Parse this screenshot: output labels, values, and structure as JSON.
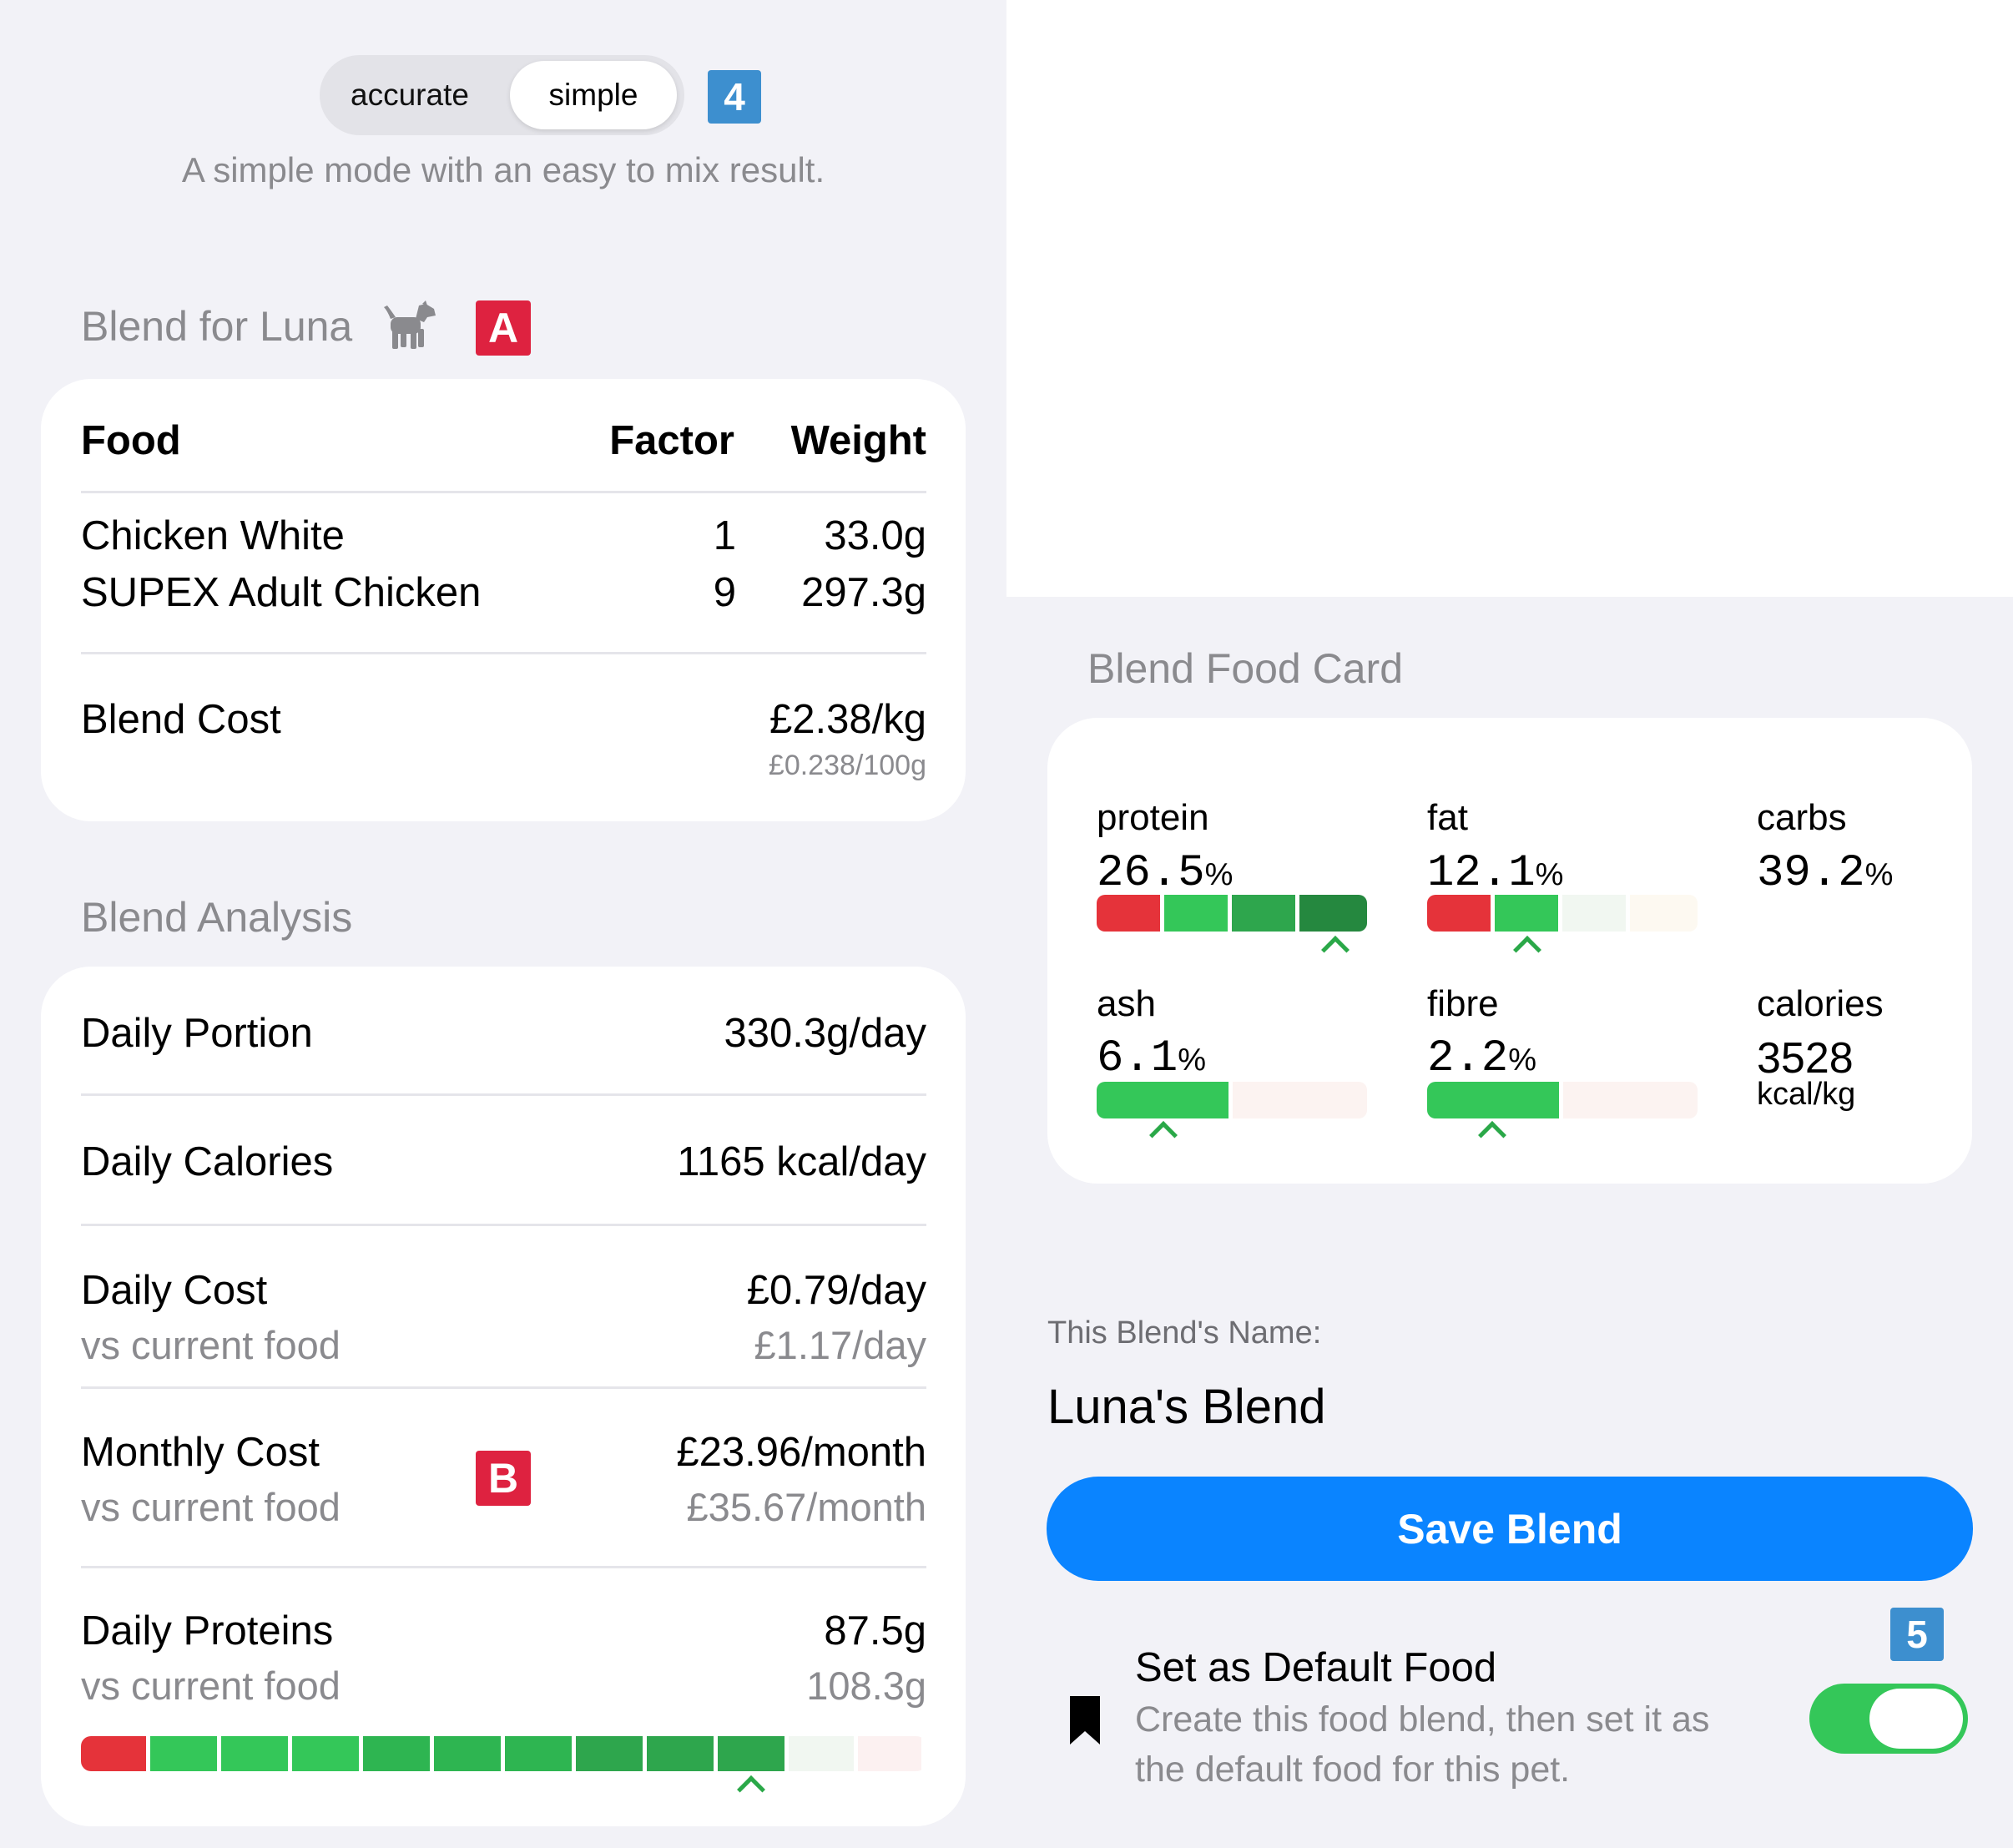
{
  "mode": {
    "options": [
      "accurate",
      "simple"
    ],
    "selected": "simple",
    "description": "A simple mode with an easy to mix result.",
    "badge": "4"
  },
  "blend": {
    "title": "Blend for Luna",
    "pet_icon": "dog-icon",
    "badge": "A",
    "headers": {
      "food": "Food",
      "factor": "Factor",
      "weight": "Weight"
    },
    "items": [
      {
        "food": "Chicken White",
        "factor": "1",
        "weight": "33.0g"
      },
      {
        "food": "SUPEX Adult Chicken",
        "factor": "9",
        "weight": "297.3g"
      }
    ],
    "cost_label": "Blend Cost",
    "cost_value": "£2.38/kg",
    "cost_sub": "£0.238/100g"
  },
  "analysis": {
    "title": "Blend Analysis",
    "badge": "B",
    "daily_portion": {
      "label": "Daily Portion",
      "value": "330.3g/day"
    },
    "daily_calories": {
      "label": "Daily Calories",
      "value": "1165 kcal/day"
    },
    "daily_cost": {
      "label": "Daily Cost",
      "sub": "vs current food",
      "value": "£0.79/day",
      "subvalue": "£1.17/day"
    },
    "monthly_cost": {
      "label": "Monthly Cost",
      "sub": "vs current food",
      "value": "£23.96/month",
      "subvalue": "£35.67/month"
    },
    "daily_proteins": {
      "label": "Daily Proteins",
      "sub": "vs current food",
      "value": "87.5g",
      "subvalue": "108.3g",
      "indicator_segment": 9,
      "segments": 12
    }
  },
  "food_card": {
    "title": "Blend Food Card",
    "protein": {
      "label": "protein",
      "value": "26.5",
      "unit": "%",
      "indicator_segment": 4
    },
    "fat": {
      "label": "fat",
      "value": "12.1",
      "unit": "%",
      "indicator_segment": 2
    },
    "carbs": {
      "label": "carbs",
      "value": "39.2",
      "unit": "%"
    },
    "ash": {
      "label": "ash",
      "value": "6.1",
      "unit": "%"
    },
    "fibre": {
      "label": "fibre",
      "value": "2.2",
      "unit": "%"
    },
    "calories": {
      "label": "calories",
      "value": "3528",
      "unit": "kcal/kg"
    }
  },
  "name_section": {
    "label": "This Blend's Name:",
    "value": "Luna's Blend"
  },
  "save_button": "Save Blend",
  "default_food": {
    "title": "Set as Default Food",
    "description_line1": "Create this food blend, then set it as",
    "description_line2": "the default food for this pet.",
    "enabled": true,
    "badge": "5",
    "icon": "bookmark-icon"
  },
  "colors": {
    "red": "#e5333a",
    "green": "#34c759",
    "green_mid": "#2ea64d",
    "green_dark": "#25883f",
    "accent": "#0a84ff"
  }
}
